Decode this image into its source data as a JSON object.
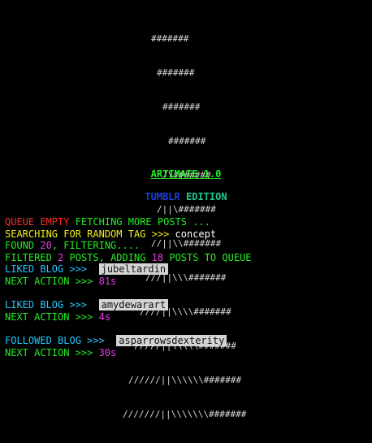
{
  "logo": {
    "lines": [
      "#######",
      "#######",
      "#######",
      "#######",
      "/\\#######",
      "/||\\#######",
      "//||\\\\#######",
      "///||\\\\\\#######",
      "////||\\\\\\\\#######",
      "/////||\\\\\\\\\\#######",
      "//////||\\\\\\\\\\\\#######",
      "///////||\\\\\\\\\\\\\\#######"
    ]
  },
  "title": "ARTIMATE 1.0",
  "edition": {
    "tumblr": "TUMBLR",
    "word": "EDITION"
  },
  "log": {
    "queue_empty": "QUEUE EMPTY",
    "fetching": "FETCHING MORE POSTS ...",
    "searching": "SEARCHING FOR RANDOM TAG >>>",
    "tag": "concept",
    "found_prefix": "FOUND",
    "found_count": "20",
    "found_suffix": ", FILTERING....",
    "filtered_prefix": "FILTERED",
    "filtered_count": "2",
    "filtered_mid": "POSTS, ADDING",
    "adding_count": "18",
    "filtered_suffix": "POSTS TO QUEUE",
    "liked_label": "LIKED BLOG >>>",
    "followed_label": "FOLLOWED BLOG >>>",
    "next_action_label": "NEXT ACTION >>>",
    "entries": [
      {
        "blog": "jubeltardin",
        "next": "81s"
      },
      {
        "blog": "amydewarart",
        "next": "4s"
      },
      {
        "blog": "asparrowsdexterity",
        "next": "30s"
      }
    ]
  },
  "colors": {
    "background": "#000000",
    "red": "#ff2a2a",
    "green": "#22ee22",
    "yellow": "#f0ee1a",
    "teal": "#22e0b0",
    "cyan": "#22c8ff",
    "magenta": "#e040e0",
    "blue": "#1a3fe0"
  }
}
